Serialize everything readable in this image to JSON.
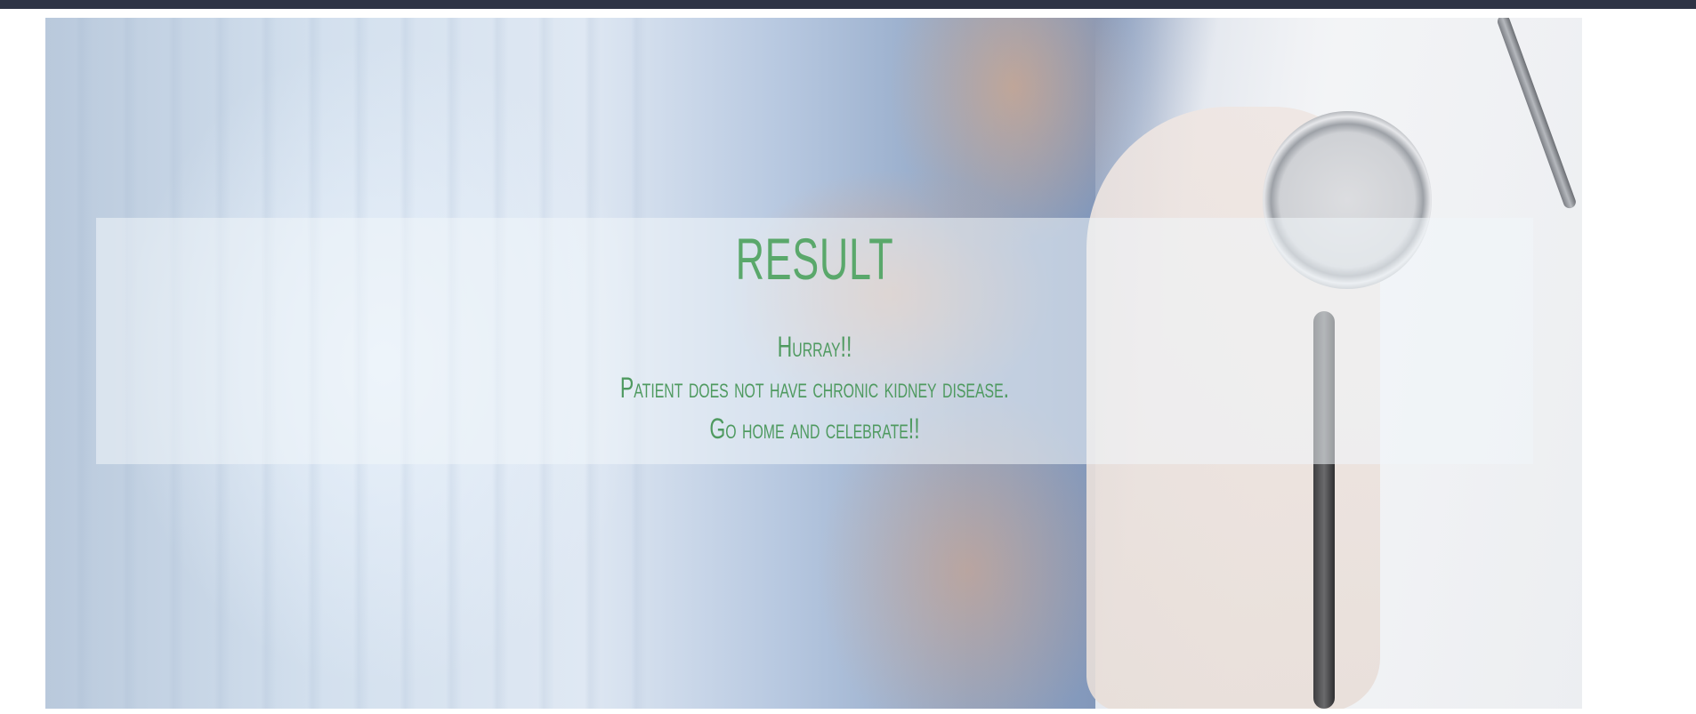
{
  "result": {
    "title": "RESULT",
    "lines": [
      "Hurray!!",
      "Patient does not have chronic kidney disease.",
      "Go home and celebrate!!"
    ]
  },
  "colors": {
    "top_bar": "#2e3445",
    "heading_green": "#5aa86b",
    "text_green": "#4f9a60",
    "panel_overlay": "rgba(240,246,250,0.55)"
  },
  "icons": {
    "hero_image": "doctor-with-stethoscope-photo"
  }
}
